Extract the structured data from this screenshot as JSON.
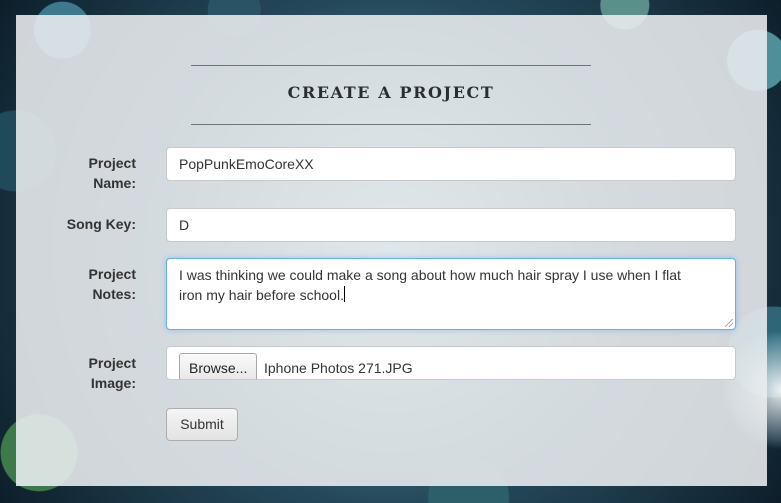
{
  "form": {
    "title": "CREATE A PROJECT",
    "fields": {
      "project_name": {
        "label_line1": "Project",
        "label_line2": "Name:",
        "value": "PopPunkEmoCoreXX"
      },
      "song_key": {
        "label": "Song Key:",
        "value": "D"
      },
      "project_notes": {
        "label_line1": "Project",
        "label_line2": "Notes:",
        "value_line1": "I was thinking we could make a song about how much hair spray I use when I flat",
        "value_line2": "iron my hair before school."
      },
      "project_image": {
        "label_line1": "Project",
        "label_line2": "Image:",
        "browse_label": "Browse...",
        "file_name": "Iphone Photos 271.JPG"
      }
    },
    "submit_label": "Submit"
  }
}
